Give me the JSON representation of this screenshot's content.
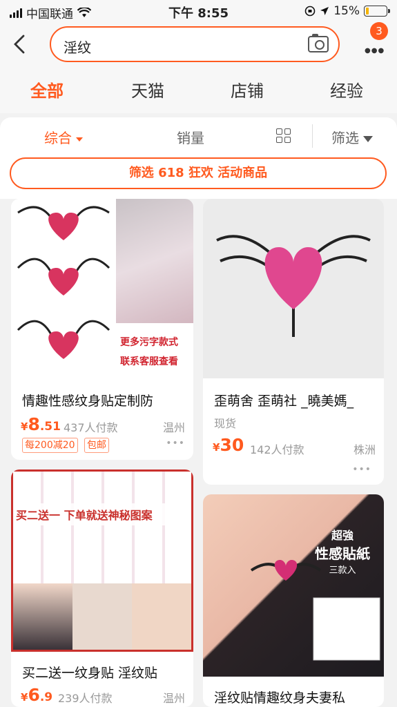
{
  "status": {
    "carrier": "中国联通",
    "time": "下午 8:55",
    "battery": "15%",
    "battery_level": 0.15
  },
  "search": {
    "query": "淫纹",
    "cart_badge": "3"
  },
  "icons": {
    "back": "chevron-left-icon",
    "camera": "camera-icon",
    "more": "more-icon",
    "grid": "grid-view-icon",
    "filter": "funnel-icon",
    "wifi": "wifi-icon",
    "location": "location-arrow-icon",
    "lock": "orientation-lock-icon"
  },
  "tabs": [
    "全部",
    "天猫",
    "店铺",
    "经验"
  ],
  "sort": {
    "default": "综合",
    "sales": "销量",
    "filter": "筛选"
  },
  "promo": "筛选 618 狂欢 活动商品",
  "colors": {
    "accent": "#ff5a1f"
  },
  "products": [
    {
      "title": "情趣性感纹身贴定制防",
      "price_int": "8",
      "price_dec": ".51",
      "sold": "437人付款",
      "location": "温州",
      "tags": [
        "每200减20",
        "包邮"
      ],
      "overlay": [
        "更多污字款式",
        "联系客服查看"
      ]
    },
    {
      "title": "歪萌舍 歪萌社 _曉美媽_",
      "avail": "现货",
      "price_int": "30",
      "price_dec": "",
      "sold": "142人付款",
      "location": "株洲"
    },
    {
      "title": "买二送一纹身贴 淫纹贴",
      "price_int": "6",
      "price_dec": ".9",
      "sold": "239人付款",
      "location": "温州",
      "overlay": [
        "买二送一 下单就送神秘图案"
      ]
    },
    {
      "title": "淫纹贴情趣纹身夫妻私",
      "overlay": [
        "超強",
        "性感貼紙",
        "三款入"
      ]
    }
  ]
}
